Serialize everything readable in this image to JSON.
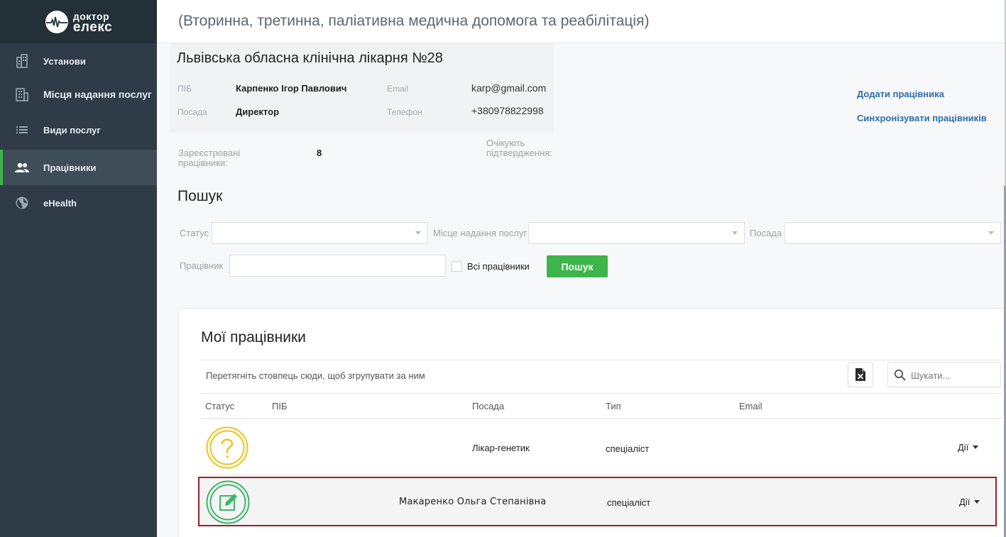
{
  "brand": {
    "line1": "доктор",
    "line2": "елекс"
  },
  "sidebar": {
    "items": [
      {
        "label": "Установи",
        "icon": "building-icon",
        "active": false
      },
      {
        "label": "Місця надання послуг",
        "icon": "office-building-icon",
        "active": false
      },
      {
        "label": "Види послуг",
        "icon": "list-icon",
        "active": false
      },
      {
        "label": "Працівники",
        "icon": "people-icon",
        "active": true
      },
      {
        "label": "eHealth",
        "icon": "globe-icon",
        "active": false
      }
    ]
  },
  "header": {
    "title": "(Вторинна, третинна, паліативна медична допомога та реабілітація)"
  },
  "org": {
    "name": "Львівська обласна клінічна лікарня №28",
    "pib_label": "ПІБ",
    "pib_value": "Карпенко Ігор Павлович",
    "position_label": "Посада",
    "position_value": "Директор",
    "email_label": "Email",
    "email_value": "karp@gmail.com",
    "phone_label": "Телефон",
    "phone_value": "+380978822998"
  },
  "actions": {
    "add_employee": "Додати працівника",
    "sync_employees": "Синхронізувати працівників"
  },
  "stats": {
    "registered_label_1": "Зареєстровані",
    "registered_label_2": "працівники:",
    "registered_value": "8",
    "pending_label_1": "Очікують",
    "pending_label_2": "підтвердження:"
  },
  "search": {
    "title": "Пошук",
    "status_label": "Статус",
    "place_label": "Місце надання послуг",
    "position_label": "Посада",
    "employee_label": "Працівник",
    "all_employees_label": "Всі працівники",
    "button": "Пошук"
  },
  "grid": {
    "title": "Мої працівники",
    "group_hint": "Перетягніть стовпець сюди, щоб згрупувати за ним",
    "search_placeholder": "Шукати...",
    "columns": {
      "status": "Статус",
      "pib": "ПІБ",
      "position": "Посада",
      "type": "Тип",
      "email": "Email"
    },
    "rows": [
      {
        "status_icon": "question-icon",
        "status_color": "#f0c419",
        "pib": "",
        "position": "Лікар-генетик",
        "type": "спеціаліст",
        "email": "",
        "actions": "Дії"
      },
      {
        "status_icon": "edit-icon",
        "status_color": "#3db56a",
        "pib": "Макаренко Ольга Степанівна",
        "position": "",
        "type": "спеціаліст",
        "email": "",
        "actions": "Дії"
      }
    ]
  },
  "colors": {
    "sidebar": "#2f3c48",
    "accent_green": "#3db54a",
    "link_blue": "#2e6da8",
    "highlight_border": "#9b1f2e"
  }
}
